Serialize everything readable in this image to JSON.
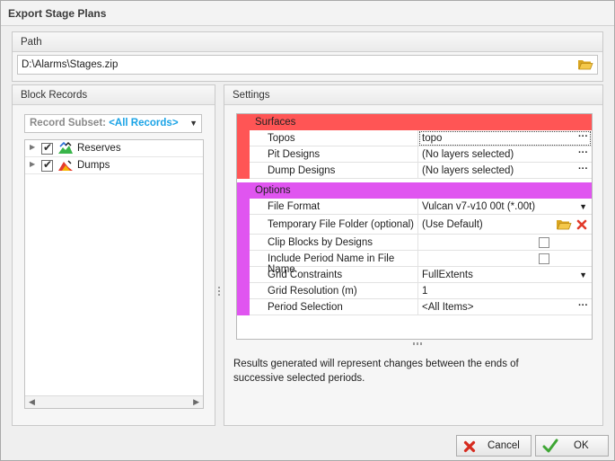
{
  "window": {
    "title": "Export Stage Plans"
  },
  "path_group": {
    "title": "Path",
    "value": "D:\\Alarms\\Stages.zip"
  },
  "block_records": {
    "title": "Block Records",
    "subset_label": "Record Subset:",
    "subset_value": "<All Records>",
    "items": [
      {
        "label": "Reserves",
        "checked": true,
        "icon": "reserves-icon"
      },
      {
        "label": "Dumps",
        "checked": true,
        "icon": "dumps-icon"
      }
    ]
  },
  "settings": {
    "title": "Settings",
    "categories": [
      {
        "name": "Surfaces",
        "color": "#ff5555",
        "rows": [
          {
            "name": "Topos",
            "value": "topo",
            "editor": "ellipsis"
          },
          {
            "name": "Pit Designs",
            "value": "(No layers selected)",
            "editor": "ellipsis"
          },
          {
            "name": "Dump Designs",
            "value": "(No layers selected)",
            "editor": "ellipsis"
          }
        ]
      },
      {
        "name": "Options",
        "color": "#e055f0",
        "rows": [
          {
            "name": "File Format",
            "value": "Vulcan v7-v10 00t (*.00t)",
            "editor": "dropdown"
          },
          {
            "name": "Temporary File Folder (optional)",
            "value": "(Use Default)",
            "editor": "folder"
          },
          {
            "name": "Clip Blocks by Designs",
            "value": "",
            "editor": "checkbox"
          },
          {
            "name": "Include Period Name in File Name",
            "value": "",
            "editor": "checkbox"
          },
          {
            "name": "Grid Constraints",
            "value": "FullExtents",
            "editor": "dropdown"
          },
          {
            "name": "Grid Resolution (m)",
            "value": "1",
            "editor": "text"
          },
          {
            "name": "Period Selection",
            "value": "<All Items>",
            "editor": "ellipsis"
          }
        ]
      }
    ],
    "description": "Results generated will represent changes between the ends of successive selected periods."
  },
  "buttons": {
    "cancel": {
      "label": "Cancel",
      "icon": "red-x-icon"
    },
    "ok": {
      "label": "OK",
      "icon": "green-check-icon"
    }
  },
  "colors": {
    "surfaces": "#ff5555",
    "options": "#e055f0",
    "link": "#1aa3e6"
  }
}
